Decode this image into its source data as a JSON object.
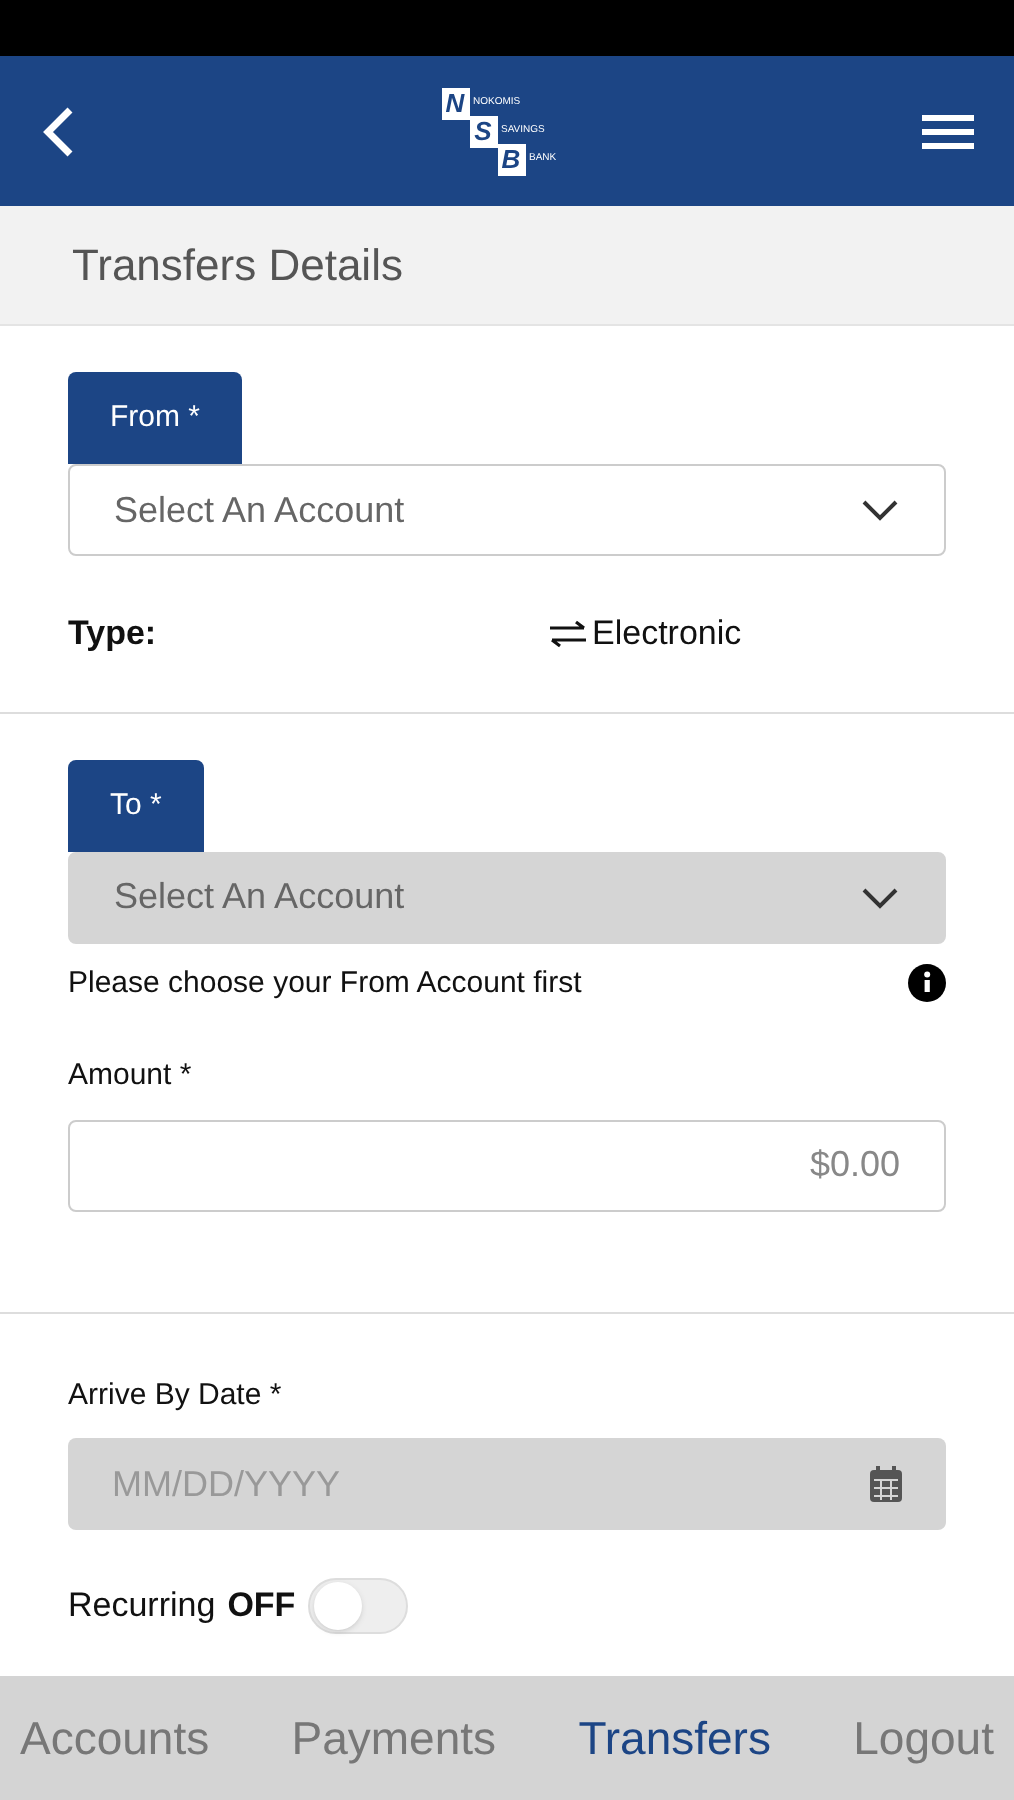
{
  "header": {
    "logo": {
      "letters": [
        "N",
        "S",
        "B"
      ],
      "words": [
        "NOKOMIS",
        "SAVINGS",
        "BANK"
      ]
    }
  },
  "page_title": "Transfers Details",
  "from": {
    "tab": "From *",
    "select": {
      "placeholder": "Select An Account",
      "disabled": false
    }
  },
  "type": {
    "label": "Type:",
    "value": "Electronic"
  },
  "to": {
    "tab": "To *",
    "select": {
      "placeholder": "Select An Account",
      "disabled": true
    },
    "hint": "Please choose your From Account first"
  },
  "amount": {
    "label": "Amount *",
    "placeholder": "$0.00"
  },
  "arrive_by": {
    "label": "Arrive By Date *",
    "placeholder": "MM/DD/YYYY",
    "disabled": true
  },
  "recurring": {
    "label": "Recurring",
    "state": "OFF",
    "on": false
  },
  "bottom_nav": [
    {
      "label": "Accounts",
      "selected": false
    },
    {
      "label": "Payments",
      "selected": false
    },
    {
      "label": "Transfers",
      "selected": true
    },
    {
      "label": "Logout",
      "selected": false
    }
  ]
}
